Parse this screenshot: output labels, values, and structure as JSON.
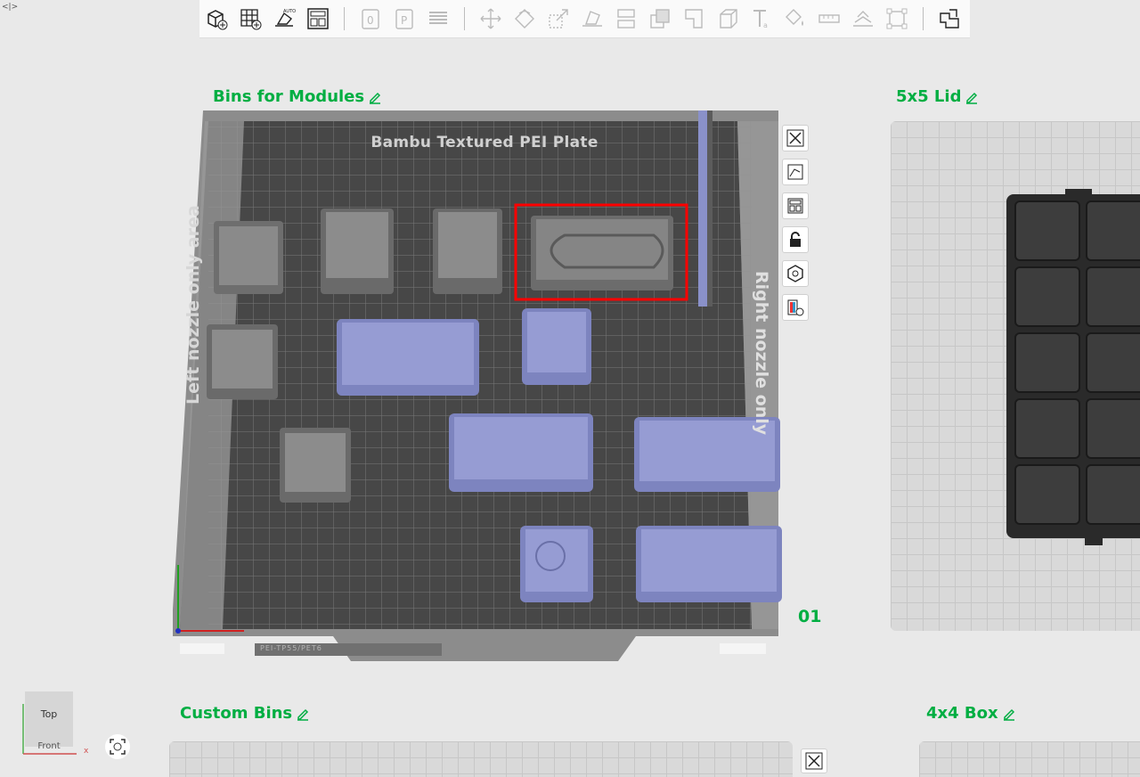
{
  "corner_tag": "<|>",
  "toolbar": {
    "groups": [
      [
        "add-cube-icon",
        "add-plate-icon",
        "auto-orient-icon",
        "arrange-icon"
      ],
      [
        "plate-0-icon",
        "plate-p-icon",
        "layers-icon"
      ],
      [
        "move-icon",
        "rotate-icon",
        "scale-icon",
        "lay-on-face-icon",
        "split-icon",
        "boolean-icon",
        "cut-icon",
        "support-icon",
        "text-icon",
        "paint-icon",
        "measure-icon",
        "seam-icon",
        "assemble-icon"
      ],
      [
        "assembly-view-icon"
      ]
    ]
  },
  "plates": {
    "main": {
      "name": "Bins for Modules",
      "title": "Bambu Textured PEI Plate",
      "left_label": "Left nozzle only area",
      "right_label": "Right nozzle only",
      "index": "01",
      "logo_text": "PEI-TP55/PET6"
    },
    "right": {
      "name": "5x5 Lid"
    },
    "bottom_left": {
      "name": "Custom Bins"
    },
    "bottom_right": {
      "name": "4x4 Box"
    }
  },
  "plate_tools": [
    "close-icon",
    "orient-plate-icon",
    "arrange-plate-icon",
    "lock-icon",
    "settings-hex-icon",
    "filament-map-icon"
  ],
  "view_cube": {
    "top": "Top",
    "front": "Front",
    "axis_x": "x"
  },
  "colors": {
    "accent": "#00ae42",
    "selection": "#ff0000",
    "object_blue": "#8a91c9",
    "object_gray": "#7a7a7a"
  }
}
